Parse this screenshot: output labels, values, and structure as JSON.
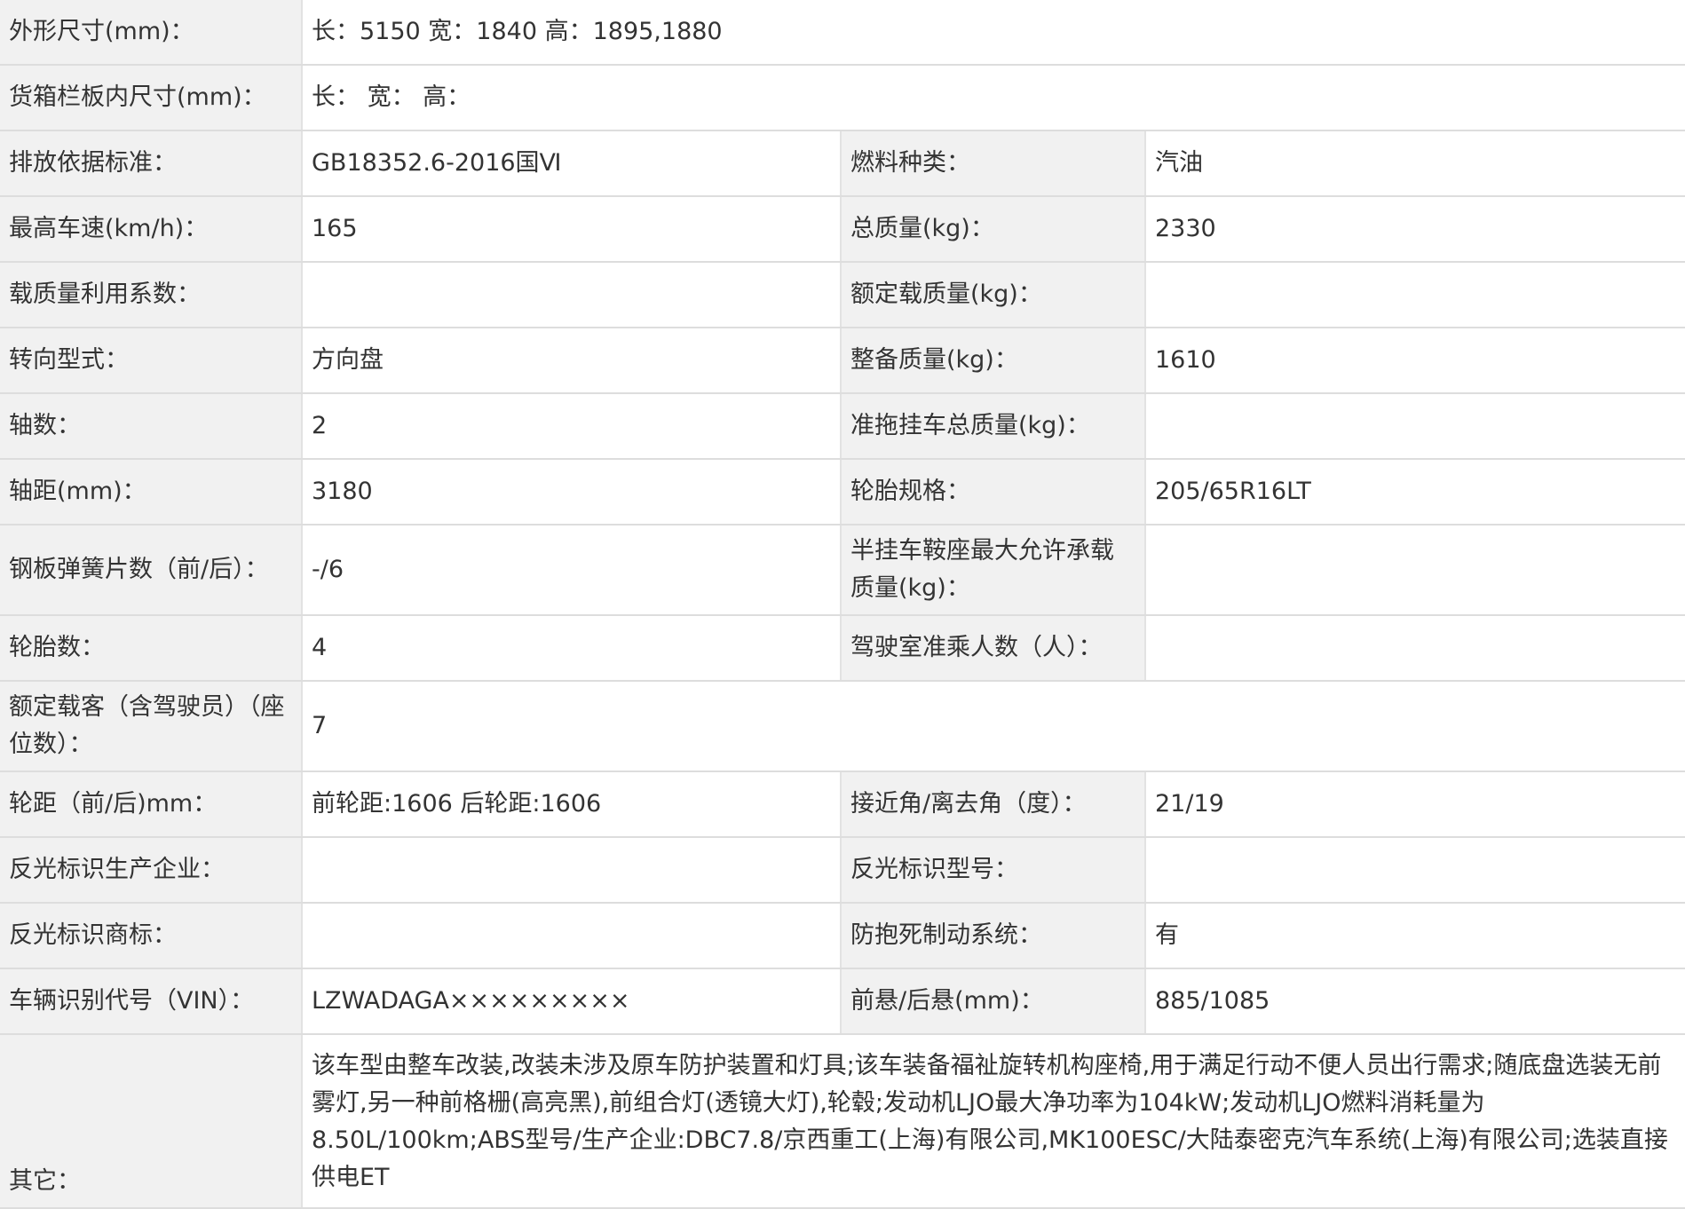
{
  "rows": [
    {
      "type": "wide",
      "label": "外形尺寸(mm)：",
      "value": "长：5150 宽：1840 高：1895,1880"
    },
    {
      "type": "wide",
      "label": "货箱栏板内尺寸(mm)：",
      "value": "长： 宽： 高："
    },
    {
      "type": "pair",
      "label1": "排放依据标准：",
      "value1": "GB18352.6-2016国Ⅵ",
      "label2": "燃料种类：",
      "value2": "汽油"
    },
    {
      "type": "pair",
      "label1": "最高车速(km/h)：",
      "value1": "165",
      "label2": "总质量(kg)：",
      "value2": "2330"
    },
    {
      "type": "pair",
      "label1": "载质量利用系数：",
      "value1": "",
      "label2": "额定载质量(kg)：",
      "value2": ""
    },
    {
      "type": "pair",
      "label1": "转向型式：",
      "value1": "方向盘",
      "label2": "整备质量(kg)：",
      "value2": "1610"
    },
    {
      "type": "pair",
      "label1": "轴数：",
      "value1": "2",
      "label2": "准拖挂车总质量(kg)：",
      "value2": ""
    },
    {
      "type": "pair",
      "label1": "轴距(mm)：",
      "value1": "3180",
      "label2": "轮胎规格：",
      "value2": "205/65R16LT"
    },
    {
      "type": "pair",
      "label1": "钢板弹簧片数（前/后）：",
      "value1": "-/6",
      "label2": "半挂车鞍座最大允许承载质量(kg)：",
      "value2": ""
    },
    {
      "type": "pair",
      "label1": "轮胎数：",
      "value1": "4",
      "label2": "驾驶室准乘人数（人）：",
      "value2": ""
    },
    {
      "type": "wide",
      "label": "额定载客（含驾驶员）（座位数）：",
      "value": "7"
    },
    {
      "type": "pair",
      "label1": "轮距（前/后)mm：",
      "value1": "前轮距:1606 后轮距:1606",
      "label2": "接近角/离去角（度）：",
      "value2": "21/19"
    },
    {
      "type": "pair",
      "label1": "反光标识生产企业：",
      "value1": "",
      "label2": "反光标识型号：",
      "value2": ""
    },
    {
      "type": "pair",
      "label1": "反光标识商标：",
      "value1": "",
      "label2": "防抱死制动系统：",
      "value2": "有"
    },
    {
      "type": "pair",
      "label1": "车辆识别代号（VIN）：",
      "value1": "LZWADAGA×××××××××",
      "label2": "前悬/后悬(mm)：",
      "value2": "885/1085"
    },
    {
      "type": "wide",
      "label": "其它：",
      "value": "该车型由整车改装,改装未涉及原车防护装置和灯具;该车装备福祉旋转机构座椅,用于满足行动不便人员出行需求;随底盘选装无前雾灯,另一种前格栅(高亮黑),前组合灯(透镜大灯),轮毂;发动机LJO最大净功率为104kW;发动机LJO燃料消耗量为8.50L/100km;ABS型号/生产企业:DBC7.8/京西重工(上海)有限公司,MK100ESC/大陆泰密克汽车系统(上海)有限公司;选装直接供电ET"
    }
  ]
}
